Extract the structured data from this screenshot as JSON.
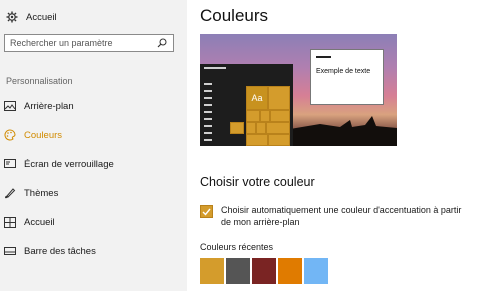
{
  "sidebar": {
    "home_label": "Accueil",
    "search_placeholder": "Rechercher un paramètre",
    "section_label": "Personnalisation",
    "items": [
      {
        "label": "Arrière-plan",
        "icon": "image-icon",
        "active": false
      },
      {
        "label": "Couleurs",
        "icon": "palette-icon",
        "active": true
      },
      {
        "label": "Écran de verrouillage",
        "icon": "lock-screen-icon",
        "active": false
      },
      {
        "label": "Thèmes",
        "icon": "brush-icon",
        "active": false
      },
      {
        "label": "Accueil",
        "icon": "start-grid-icon",
        "active": false
      },
      {
        "label": "Barre des tâches",
        "icon": "taskbar-icon",
        "active": false
      }
    ]
  },
  "main": {
    "title": "Couleurs",
    "preview": {
      "tile_text": "Aa",
      "window_text": "Exemple de texte"
    },
    "subtitle": "Choisir votre couleur",
    "auto_accent": {
      "checked": true,
      "label": "Choisir automatiquement une couleur d'accentuation à partir de mon arrière-plan"
    },
    "recent_label": "Couleurs récentes",
    "recent_colors": [
      "#d49c2c",
      "#555555",
      "#7a2423",
      "#e07b00",
      "#72b6f5"
    ]
  },
  "colors": {
    "accent": "#d18b00",
    "sidebar_bg": "#f2f2f2"
  }
}
